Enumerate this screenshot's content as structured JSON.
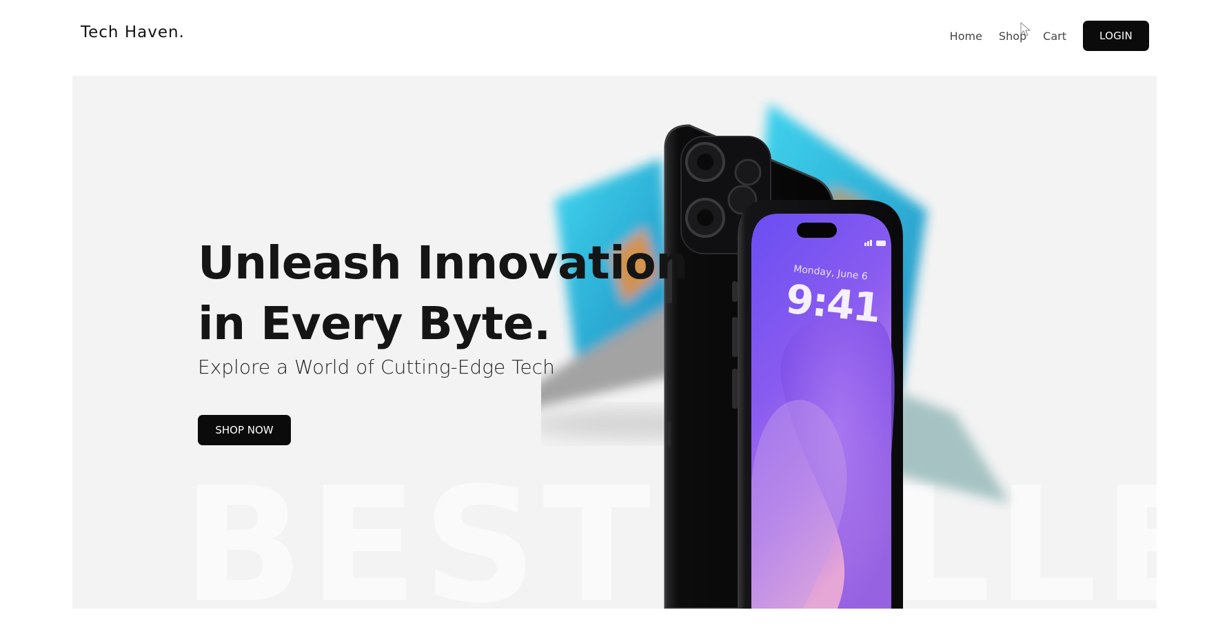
{
  "header": {
    "brand": "Tech Haven.",
    "nav": {
      "home": "Home",
      "shop": "Shop",
      "cart": "Cart",
      "login": "LOGIN"
    }
  },
  "hero": {
    "headline_line1": "Unleash Innovation",
    "headline_line2": "in Every Byte.",
    "subheadline": "Explore a World of Cutting-Edge Tech",
    "cta": "SHOP NOW",
    "watermark": "BESTSELLE",
    "phone_screen": {
      "date": "Monday, June 6",
      "time": "9:41"
    }
  },
  "colors": {
    "hero_bg": "#f3f3f3",
    "button_bg": "#0b0b0b",
    "phone_screen_purple": "#7a4ff0",
    "laptop_screen_cyan": "#2ec4e6"
  }
}
